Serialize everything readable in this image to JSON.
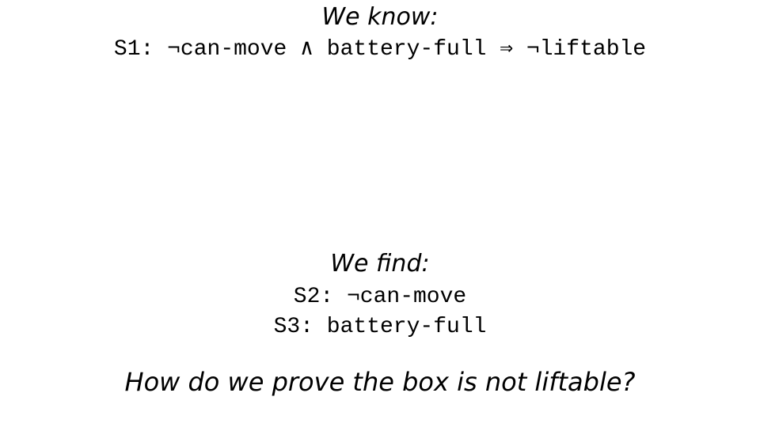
{
  "known": {
    "heading": "We know:",
    "statements": [
      "S1: ¬can-move ∧ battery-full ⇒ ¬liftable"
    ]
  },
  "found": {
    "heading": "We find:",
    "statements": [
      "S2: ¬can-move",
      "S3: battery-full"
    ]
  },
  "question": "How do we prove the box is not liftable?"
}
